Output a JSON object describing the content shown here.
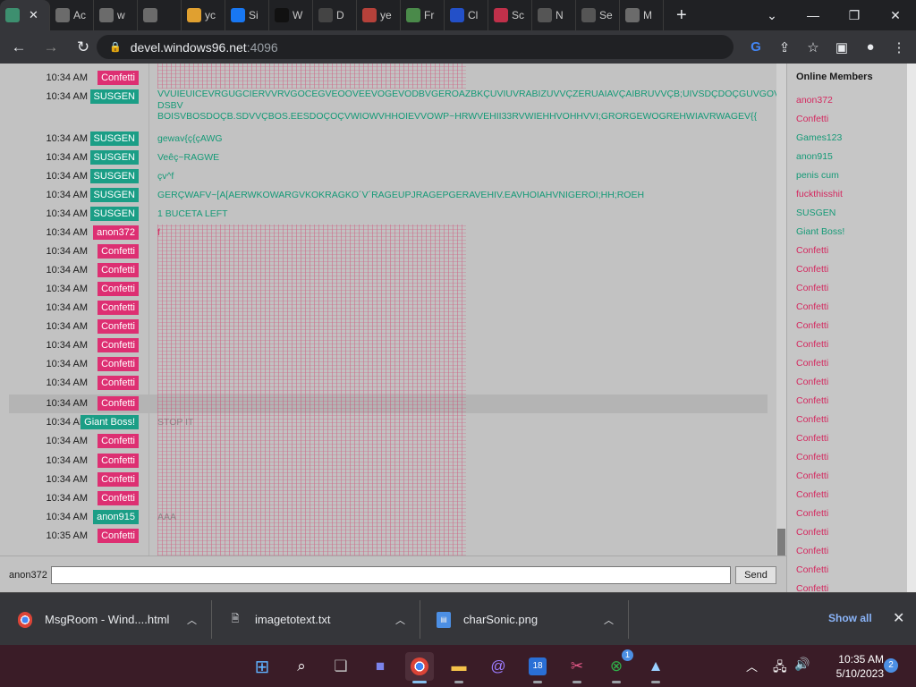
{
  "browser": {
    "tabs": [
      {
        "label": "",
        "icon": "msgroom-icon",
        "color": "#3d8f6f"
      },
      {
        "label": "Ac",
        "icon": "globe-icon",
        "color": "#6b6b6b"
      },
      {
        "label": "w",
        "icon": "globe-icon",
        "color": "#6b6b6b"
      },
      {
        "label": "",
        "icon": "globe-icon",
        "color": "#6b6b6b"
      },
      {
        "label": "yc",
        "icon": "yc-icon",
        "color": "#e0a030"
      },
      {
        "label": "Si",
        "icon": "facebook-icon",
        "color": "#1877f2"
      },
      {
        "label": "W",
        "icon": "wtf-icon",
        "color": "#111111"
      },
      {
        "label": "D",
        "icon": "download-icon",
        "color": "#444444"
      },
      {
        "label": "ye",
        "icon": "shield-icon",
        "color": "#b5413a"
      },
      {
        "label": "Fr",
        "icon": "fr-icon",
        "color": "#4a8a4a"
      },
      {
        "label": "Cl",
        "icon": "sonic-icon",
        "color": "#2350c8"
      },
      {
        "label": "Sc",
        "icon": "target-icon",
        "color": "#c0304a"
      },
      {
        "label": "N",
        "icon": "n-icon",
        "color": "#555555"
      },
      {
        "label": "Se",
        "icon": "gear-icon",
        "color": "#555555"
      },
      {
        "label": "M",
        "icon": "globe-icon",
        "color": "#6b6b6b"
      }
    ],
    "url": "devel.windows96.net",
    "url_port": ":4096"
  },
  "chat": {
    "rows": [
      {
        "time": "10:34 AM",
        "nick": "Confetti",
        "color": "pink",
        "text": "",
        "msgclass": "pinkmsg"
      },
      {
        "time": "10:34 AM",
        "nick": "SUSGEN",
        "color": "teal",
        "text": "VVUIEUICEVRGUGCIERVVRVGOCEGVEOOVEEVOGEVODBVGEROAZBKÇUVIUVRABIZUVVÇZERUAIAVÇAIBRUVVÇB;UIVSDÇDOÇGUVGOVÇSGOVDGÇOS_YIDVB DSBV BOISVBOSDOÇB.SDVVÇBOS.EESDOÇOÇVWIOWVHHOIEVVOWP~HRWVEHII33RVWIEHHVOHHVVI;GRORGEWOGREHWIAVRWAGEV{{",
        "msgclass": "wrap"
      },
      {
        "time": "10:34 AM",
        "nick": "SUSGEN",
        "color": "teal",
        "text": "gewav{ç{çAWG",
        "msgclass": ""
      },
      {
        "time": "10:34 AM",
        "nick": "SUSGEN",
        "color": "teal",
        "text": "Veêç~RAGWE",
        "msgclass": ""
      },
      {
        "time": "10:34 AM",
        "nick": "SUSGEN",
        "color": "teal",
        "text": "çv^f",
        "msgclass": ""
      },
      {
        "time": "10:34 AM",
        "nick": "SUSGEN",
        "color": "teal",
        "text": "GERÇWAFV~[A[AERWKOWARGVKOKRAGKO´V´RAGEUPJRAGEPGERAVEHIV.EAVHOIAHVNIGEROI;HH;ROEH",
        "msgclass": ""
      },
      {
        "time": "10:34 AM",
        "nick": "SUSGEN",
        "color": "teal",
        "text": "1 BUCETA LEFT",
        "msgclass": ""
      },
      {
        "time": "10:34 AM",
        "nick": "anon372",
        "color": "pink",
        "text": "f",
        "msgclass": "pinkmsg"
      },
      {
        "time": "10:34 AM",
        "nick": "Confetti",
        "color": "pink",
        "text": "",
        "msgclass": "pinkmsg"
      },
      {
        "time": "10:34 AM",
        "nick": "Confetti",
        "color": "pink",
        "text": "",
        "msgclass": "pinkmsg"
      },
      {
        "time": "10:34 AM",
        "nick": "Confetti",
        "color": "pink",
        "text": "",
        "msgclass": "pinkmsg"
      },
      {
        "time": "10:34 AM",
        "nick": "Confetti",
        "color": "pink",
        "text": "",
        "msgclass": "pinkmsg"
      },
      {
        "time": "10:34 AM",
        "nick": "Confetti",
        "color": "pink",
        "text": "",
        "msgclass": "pinkmsg"
      },
      {
        "time": "10:34 AM",
        "nick": "Confetti",
        "color": "pink",
        "text": "",
        "msgclass": "pinkmsg"
      },
      {
        "time": "10:34 AM",
        "nick": "Confetti",
        "color": "pink",
        "text": "",
        "msgclass": "pinkmsg"
      },
      {
        "time": "10:34 AM",
        "nick": "Confetti",
        "color": "pink",
        "text": "",
        "msgclass": "pinkmsg"
      },
      {
        "time": "10:34 AM",
        "nick": "Confetti",
        "color": "pink",
        "text": "",
        "msgclass": "pinkmsg",
        "highlight": true
      },
      {
        "time": "10:34 AM",
        "nick": "Giant Boss!",
        "color": "teal",
        "text": "STOP IT",
        "msgclass": "grey"
      },
      {
        "time": "10:34 AM",
        "nick": "Confetti",
        "color": "pink",
        "text": "",
        "msgclass": "pinkmsg"
      },
      {
        "time": "10:34 AM",
        "nick": "Confetti",
        "color": "pink",
        "text": "",
        "msgclass": "pinkmsg"
      },
      {
        "time": "10:34 AM",
        "nick": "Confetti",
        "color": "pink",
        "text": "",
        "msgclass": "pinkmsg"
      },
      {
        "time": "10:34 AM",
        "nick": "Confetti",
        "color": "pink",
        "text": "",
        "msgclass": "pinkmsg"
      },
      {
        "time": "10:34 AM",
        "nick": "anon915",
        "color": "teal",
        "text": "AAA",
        "msgclass": "grey"
      },
      {
        "time": "10:35 AM",
        "nick": "Confetti",
        "color": "pink",
        "text": "",
        "msgclass": "pinkmsg"
      }
    ],
    "input_user": "anon372",
    "input_value": "",
    "send_label": "Send"
  },
  "members": {
    "title": "Online Members",
    "list": [
      {
        "name": "anon372",
        "color": "pink"
      },
      {
        "name": "Confetti",
        "color": "pink"
      },
      {
        "name": "Games123",
        "color": "teal"
      },
      {
        "name": "anon915",
        "color": "teal"
      },
      {
        "name": "penis cum",
        "color": "teal"
      },
      {
        "name": "fuckthisshit",
        "color": "pink"
      },
      {
        "name": "SUSGEN",
        "color": "teal"
      },
      {
        "name": "Giant Boss!",
        "color": "teal"
      },
      {
        "name": "Confetti",
        "color": "pink"
      },
      {
        "name": "Confetti",
        "color": "pink"
      },
      {
        "name": "Confetti",
        "color": "pink"
      },
      {
        "name": "Confetti",
        "color": "pink"
      },
      {
        "name": "Confetti",
        "color": "pink"
      },
      {
        "name": "Confetti",
        "color": "pink"
      },
      {
        "name": "Confetti",
        "color": "pink"
      },
      {
        "name": "Confetti",
        "color": "pink"
      },
      {
        "name": "Confetti",
        "color": "pink"
      },
      {
        "name": "Confetti",
        "color": "pink"
      },
      {
        "name": "Confetti",
        "color": "pink"
      },
      {
        "name": "Confetti",
        "color": "pink"
      },
      {
        "name": "Confetti",
        "color": "pink"
      },
      {
        "name": "Confetti",
        "color": "pink"
      },
      {
        "name": "Confetti",
        "color": "pink"
      },
      {
        "name": "Confetti",
        "color": "pink"
      },
      {
        "name": "Confetti",
        "color": "pink"
      },
      {
        "name": "Confetti",
        "color": "pink"
      },
      {
        "name": "Confetti",
        "color": "pink"
      }
    ]
  },
  "downloads": {
    "items": [
      {
        "name": "MsgRoom - Wind....html",
        "icon": "chrome-icon"
      },
      {
        "name": "imagetotext.txt",
        "icon": "text-file-icon"
      },
      {
        "name": "charSonic.png",
        "icon": "image-file-icon"
      }
    ],
    "show_all": "Show all"
  },
  "taskbar": {
    "apps": [
      "start-icon",
      "search-icon",
      "task-view-icon",
      "teams-icon",
      "chrome-icon",
      "file-explorer-icon",
      "mail-icon",
      "calendar-icon",
      "snipping-tool-icon",
      "xbox-icon",
      "photos-icon"
    ],
    "calendar_badge": "18",
    "xbox_badge": "1",
    "time": "10:35 AM",
    "date": "5/10/2023",
    "notifications": "2"
  },
  "colors": {
    "pink": "#dd2f72",
    "teal": "#1b9e86"
  }
}
